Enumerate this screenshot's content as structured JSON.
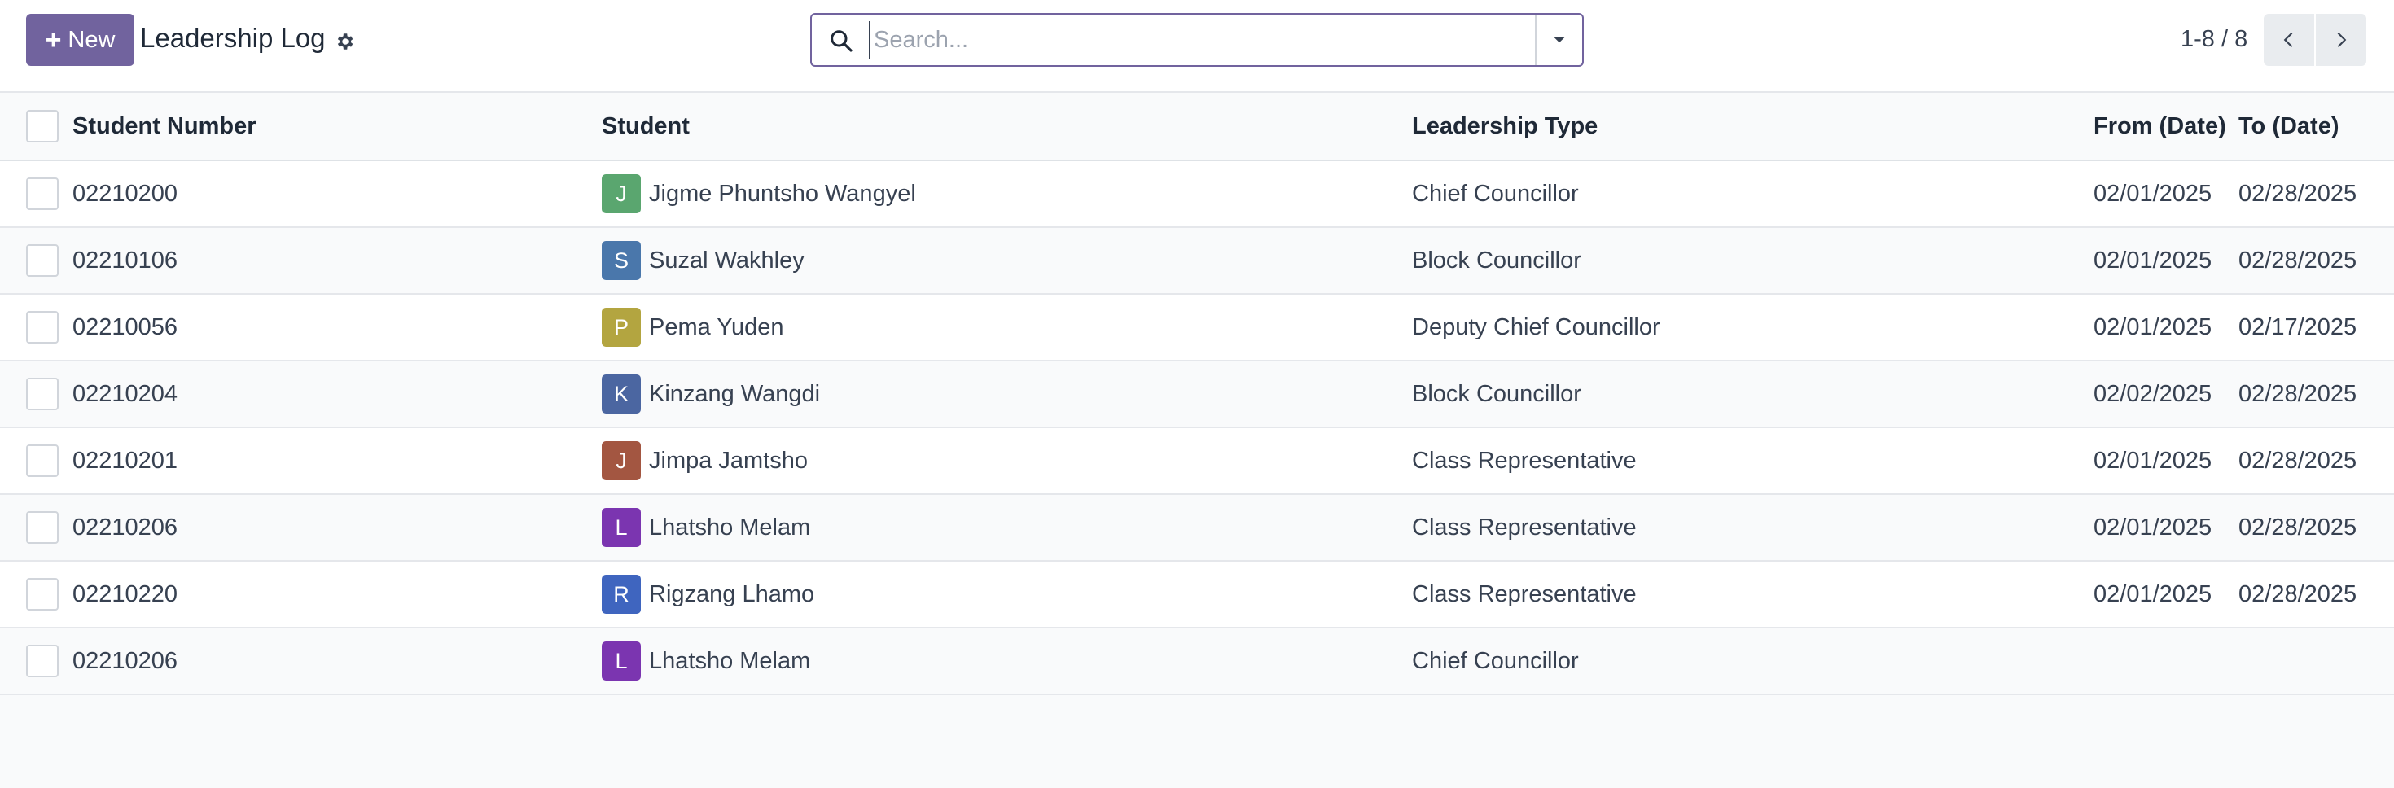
{
  "toolbar": {
    "new_label": "New",
    "title": "Leadership Log"
  },
  "search": {
    "placeholder": "Search..."
  },
  "pager": {
    "value": "1-8 / 8"
  },
  "columns": {
    "student_number": "Student Number",
    "student": "Student",
    "leadership_type": "Leadership Type",
    "from_date": "From (Date)",
    "to_date": "To (Date)"
  },
  "rows": [
    {
      "number": "02210200",
      "initial": "J",
      "avatar_color": "#5aa66f",
      "student": "Jigme Phuntsho Wangyel",
      "type": "Chief Councillor",
      "from": "02/01/2025",
      "to": "02/28/2025"
    },
    {
      "number": "02210106",
      "initial": "S",
      "avatar_color": "#4a77ab",
      "student": "Suzal Wakhley",
      "type": "Block Councillor",
      "from": "02/01/2025",
      "to": "02/28/2025"
    },
    {
      "number": "02210056",
      "initial": "P",
      "avatar_color": "#b3a540",
      "student": "Pema Yuden",
      "type": "Deputy Chief Councillor",
      "from": "02/01/2025",
      "to": "02/17/2025"
    },
    {
      "number": "02210204",
      "initial": "K",
      "avatar_color": "#4b66a1",
      "student": "Kinzang Wangdi",
      "type": "Block Councillor",
      "from": "02/02/2025",
      "to": "02/28/2025"
    },
    {
      "number": "02210201",
      "initial": "J",
      "avatar_color": "#a35641",
      "student": "Jimpa Jamtsho",
      "type": "Class Representative",
      "from": "02/01/2025",
      "to": "02/28/2025"
    },
    {
      "number": "02210206",
      "initial": "L",
      "avatar_color": "#7b35b0",
      "student": "Lhatsho Melam",
      "type": "Class Representative",
      "from": "02/01/2025",
      "to": "02/28/2025"
    },
    {
      "number": "02210220",
      "initial": "R",
      "avatar_color": "#3f65bf",
      "student": "Rigzang Lhamo",
      "type": "Class Representative",
      "from": "02/01/2025",
      "to": "02/28/2025"
    },
    {
      "number": "02210206",
      "initial": "L",
      "avatar_color": "#7b35b0",
      "student": "Lhatsho Melam",
      "type": "Chief Councillor",
      "from": "",
      "to": ""
    }
  ]
}
